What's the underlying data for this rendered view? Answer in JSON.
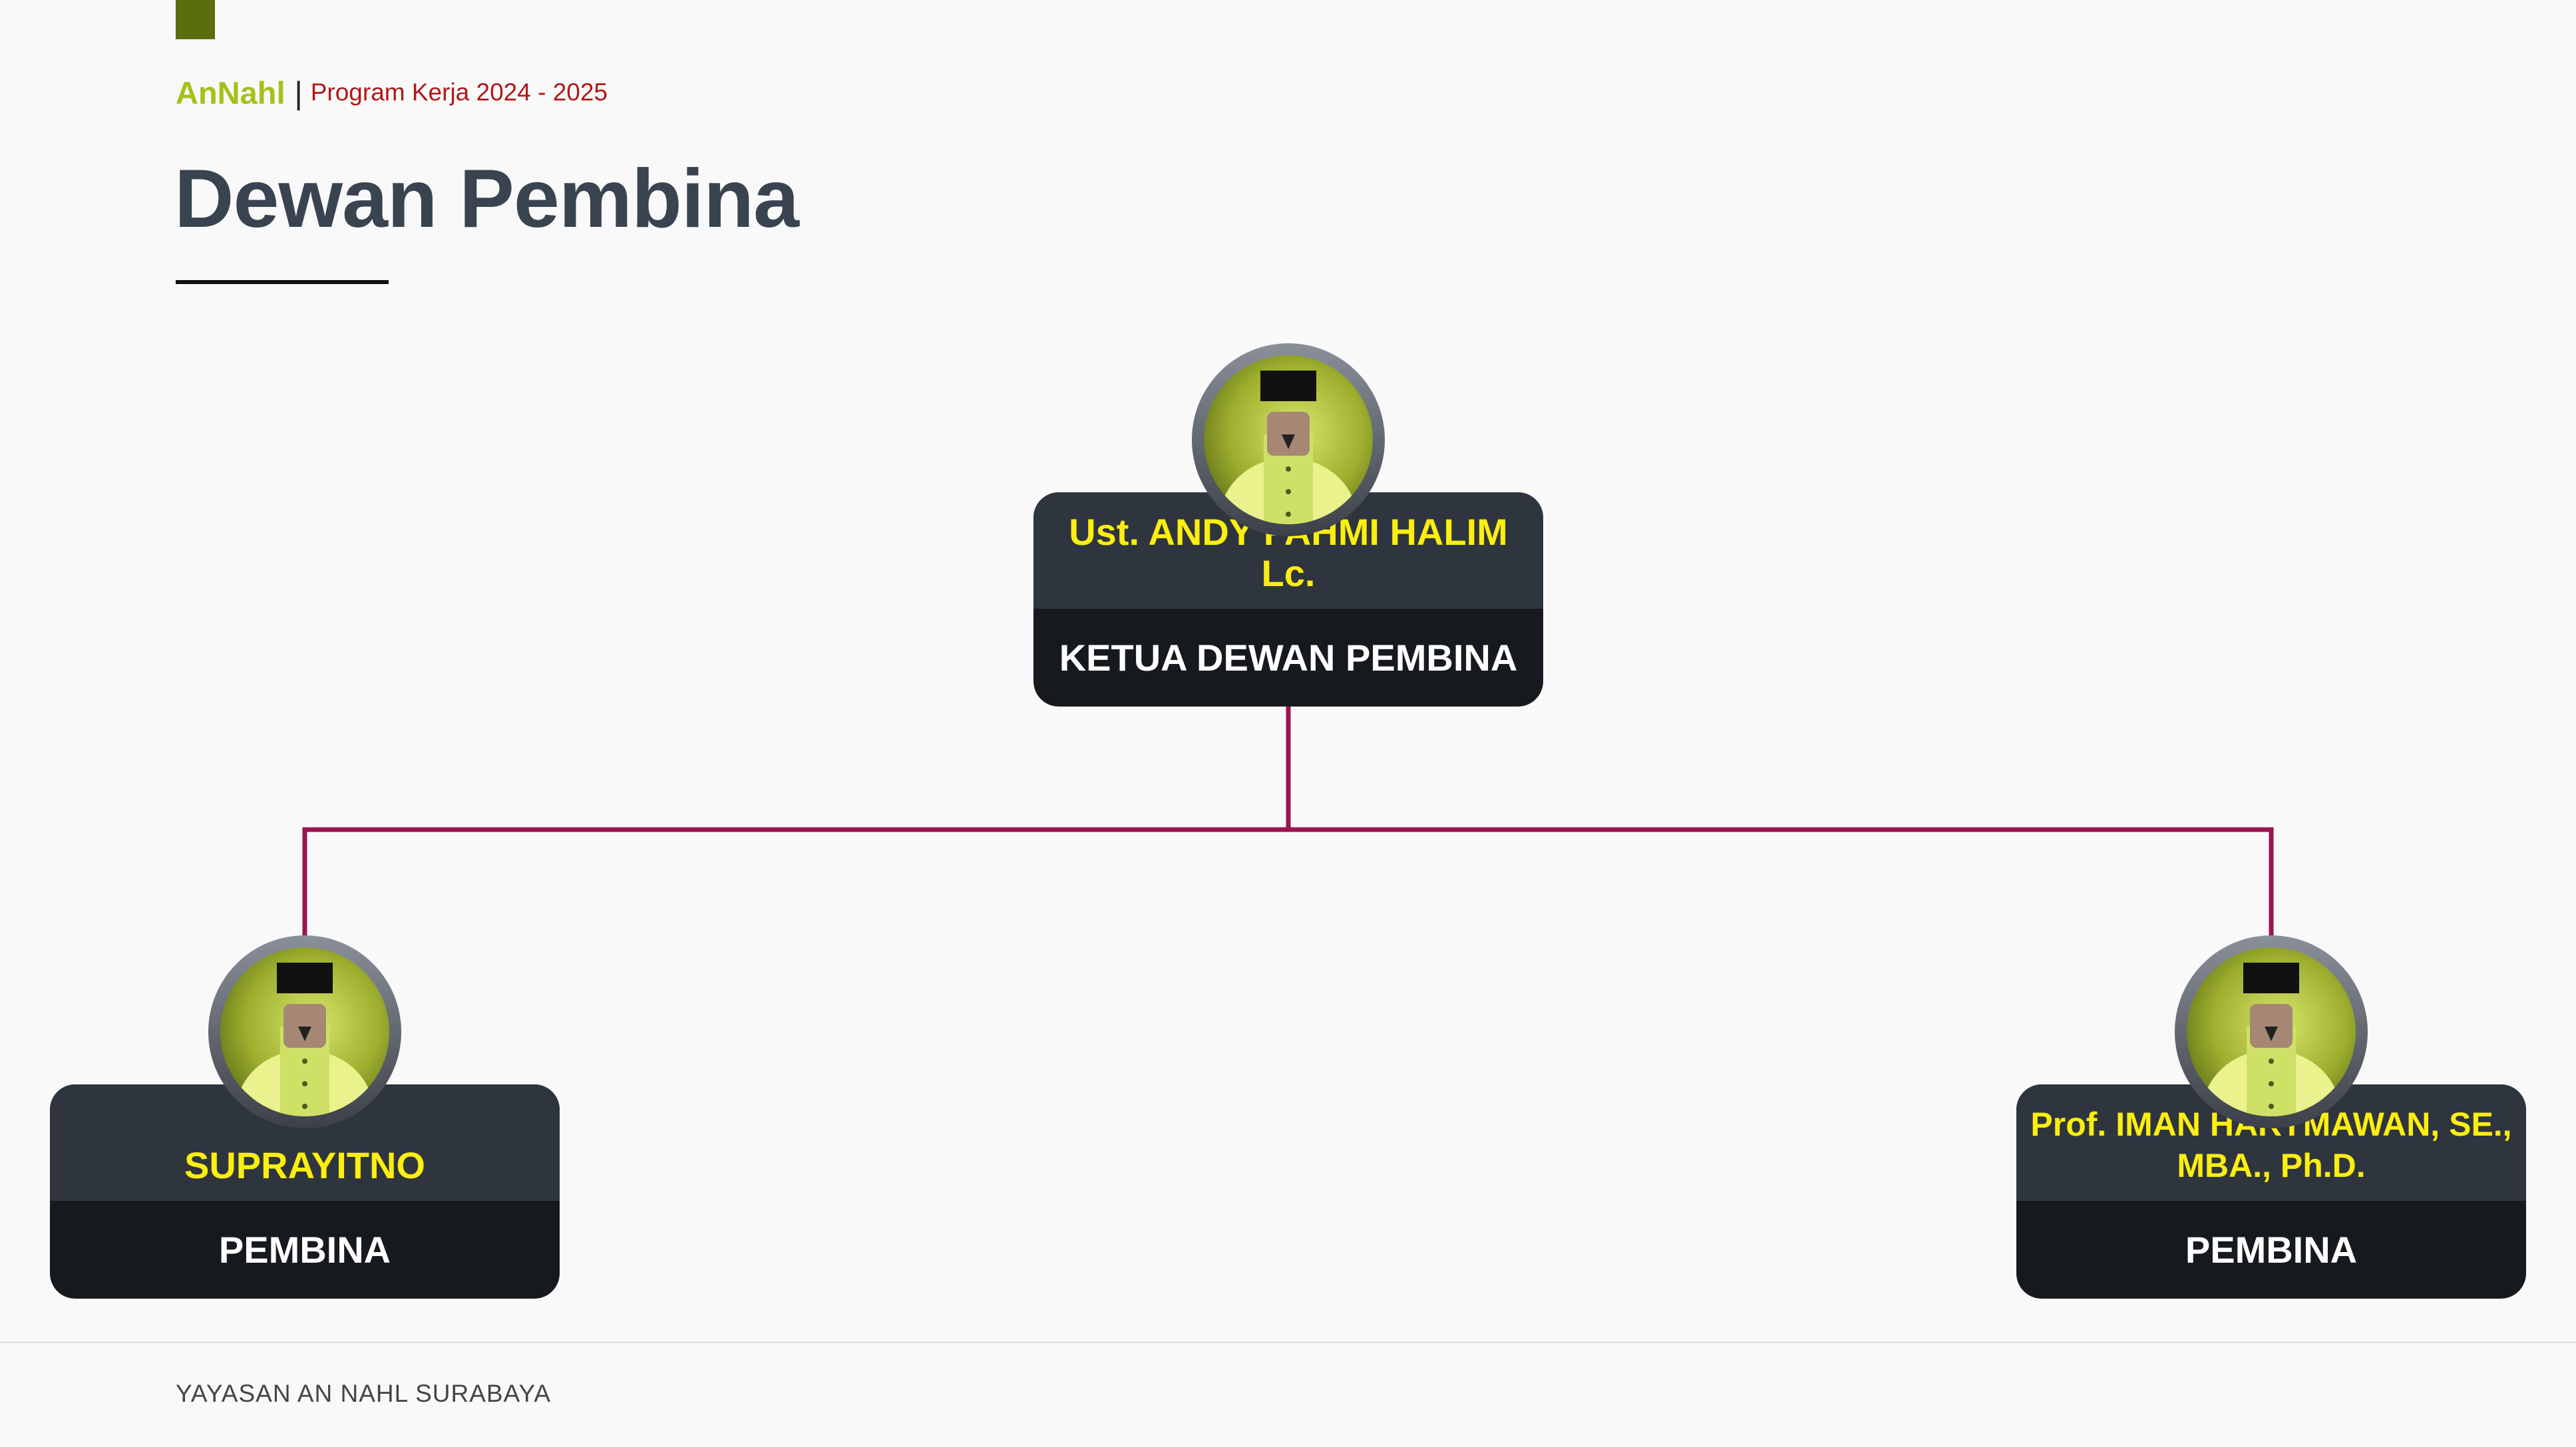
{
  "header": {
    "brand_name": "AnNahl",
    "separator": "|",
    "subtitle": "Program Kerja 2024 - 2025",
    "title": "Dewan Pembina"
  },
  "org_chart": {
    "nodes": [
      {
        "name": "Ust. ANDY FAHMI HALIM Lc.",
        "role": "KETUA DEWAN PEMBINA",
        "avatar_icon": "person-avatar-icon"
      },
      {
        "name": "SUPRAYITNO",
        "role": "PEMBINA",
        "avatar_icon": "person-avatar-icon",
        "reports_to": "Ust. ANDY FAHMI HALIM Lc."
      },
      {
        "name": "Prof. IMAN HARYMAWAN, SE., MBA., Ph.D.",
        "role": "PEMBINA",
        "avatar_icon": "person-avatar-icon",
        "reports_to": "Ust. ANDY FAHMI HALIM Lc."
      }
    ]
  },
  "footer": {
    "text": "YAYASAN AN NAHL SURABAYA"
  },
  "colors": {
    "brand_green": "#a6c01b",
    "accent_bar": "#5a6d0f",
    "subtitle_red": "#b01818",
    "title_gray": "#3a4350",
    "connector": "#9b1450",
    "name_yellow": "#fbee10",
    "card_top": "#2f353e",
    "card_bottom": "#161a1f"
  }
}
